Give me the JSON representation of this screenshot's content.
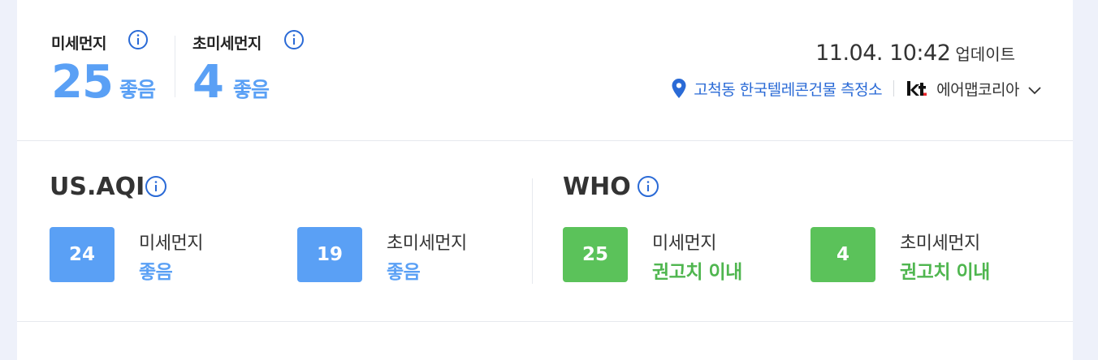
{
  "current": {
    "pm10": {
      "label": "미세먼지",
      "value": "25",
      "grade": "좋음"
    },
    "pm25": {
      "label": "초미세먼지",
      "value": "4",
      "grade": "좋음"
    }
  },
  "update": {
    "time": "11.04. 10:42",
    "text": "업데이트"
  },
  "station": {
    "name": "고척동 한국텔레콘건물 측정소",
    "provider": "에어맵코리아"
  },
  "standards": {
    "us_aqi": {
      "title": "US.AQI",
      "items": [
        {
          "label": "미세먼지",
          "value": "24",
          "grade": "좋음"
        },
        {
          "label": "초미세먼지",
          "value": "19",
          "grade": "좋음"
        }
      ]
    },
    "who": {
      "title": "WHO",
      "items": [
        {
          "label": "미세먼지",
          "value": "25",
          "grade": "권고치 이내"
        },
        {
          "label": "초미세먼지",
          "value": "4",
          "grade": "권고치 이내"
        }
      ]
    }
  },
  "colors": {
    "good_blue": "#5aa0f5",
    "good_green": "#5bc25a",
    "link_blue": "#2a6ad6"
  },
  "icons": [
    "info-icon",
    "location-pin-icon",
    "kt-logo-icon",
    "chevron-down-icon"
  ]
}
